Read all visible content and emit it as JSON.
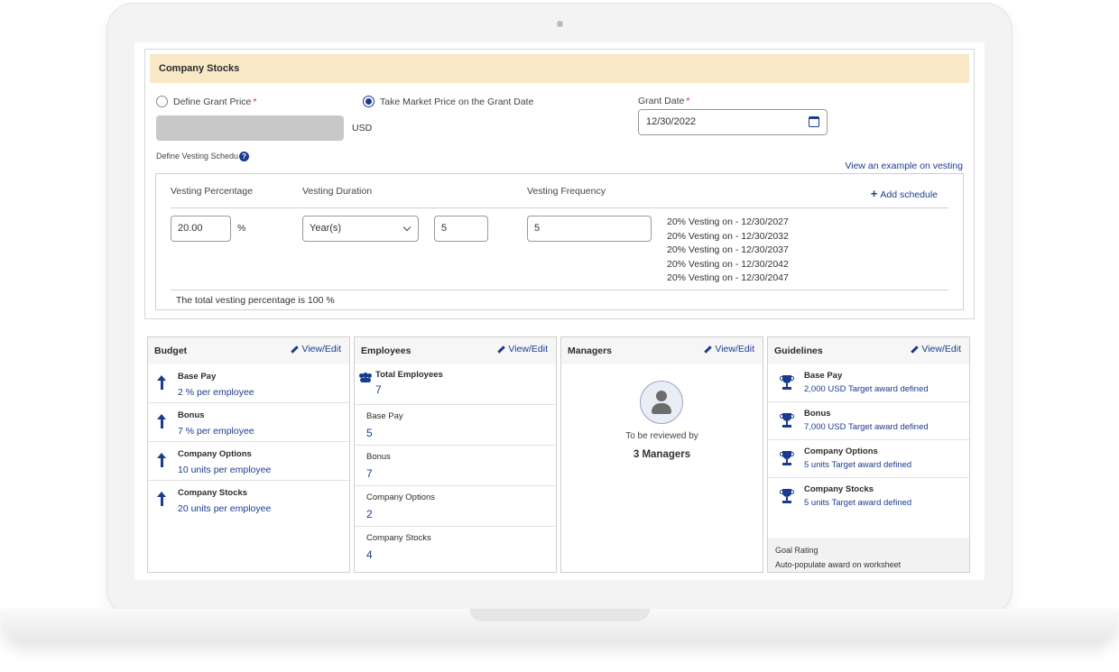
{
  "company_stocks": {
    "title": "Company Stocks",
    "define_grant_price_label": "Define Grant Price",
    "required_mark": "*",
    "take_market_price_label": "Take Market Price on the Grant Date",
    "currency": "USD",
    "grant_date_label": "Grant Date",
    "grant_date_value": "12/30/2022",
    "define_vesting_label": "Define Vesting Schedu",
    "help_glyph": "?",
    "example_link": "View an example on vesting",
    "schedule": {
      "vesting_percentage_header": "Vesting Percentage",
      "vesting_duration_header": "Vesting Duration",
      "vesting_frequency_header": "Vesting Frequency",
      "add_schedule_label": "Add schedule",
      "add_schedule_glyph": "+",
      "percentage_value": "20.00",
      "percent_sign": "%",
      "duration_unit": "Year(s)",
      "duration_value": "5",
      "frequency_value": "5",
      "vesting_lines": [
        "20% Vesting on - 12/30/2027",
        "20% Vesting on - 12/30/2032",
        "20% Vesting on - 12/30/2037",
        "20% Vesting on - 12/30/2042",
        "20% Vesting on - 12/30/2047"
      ],
      "total_text": "The total vesting percentage is 100 %"
    }
  },
  "view_edit_label": "View/Edit",
  "budget": {
    "title": "Budget",
    "items": [
      {
        "label": "Base Pay",
        "value": "2 % per employee"
      },
      {
        "label": "Bonus",
        "value": "7 % per employee"
      },
      {
        "label": "Company Options",
        "value": "10 units per employee"
      },
      {
        "label": "Company Stocks",
        "value": "20 units per employee"
      }
    ]
  },
  "employees": {
    "title": "Employees",
    "total_label": "Total Employees",
    "total_value": "7",
    "items": [
      {
        "label": "Base Pay",
        "value": "5"
      },
      {
        "label": "Bonus",
        "value": "7"
      },
      {
        "label": "Company Options",
        "value": "2"
      },
      {
        "label": "Company Stocks",
        "value": "4"
      }
    ]
  },
  "managers": {
    "title": "Managers",
    "review_text": "To be reviewed by",
    "count_text": "3 Managers"
  },
  "guidelines": {
    "title": "Guidelines",
    "items": [
      {
        "label": "Base Pay",
        "value": "2,000 USD Target award defined"
      },
      {
        "label": "Bonus",
        "value": "7,000 USD Target award defined"
      },
      {
        "label": "Company Options",
        "value": "5 units Target award defined"
      },
      {
        "label": "Company Stocks",
        "value": "5 units Target award defined"
      }
    ],
    "goal_rating_label": "Goal Rating",
    "goal_rating_value": "Auto-populate award on worksheet"
  },
  "colors": {
    "accent": "#1a3c8f",
    "header_bg": "#f8e8c6"
  }
}
